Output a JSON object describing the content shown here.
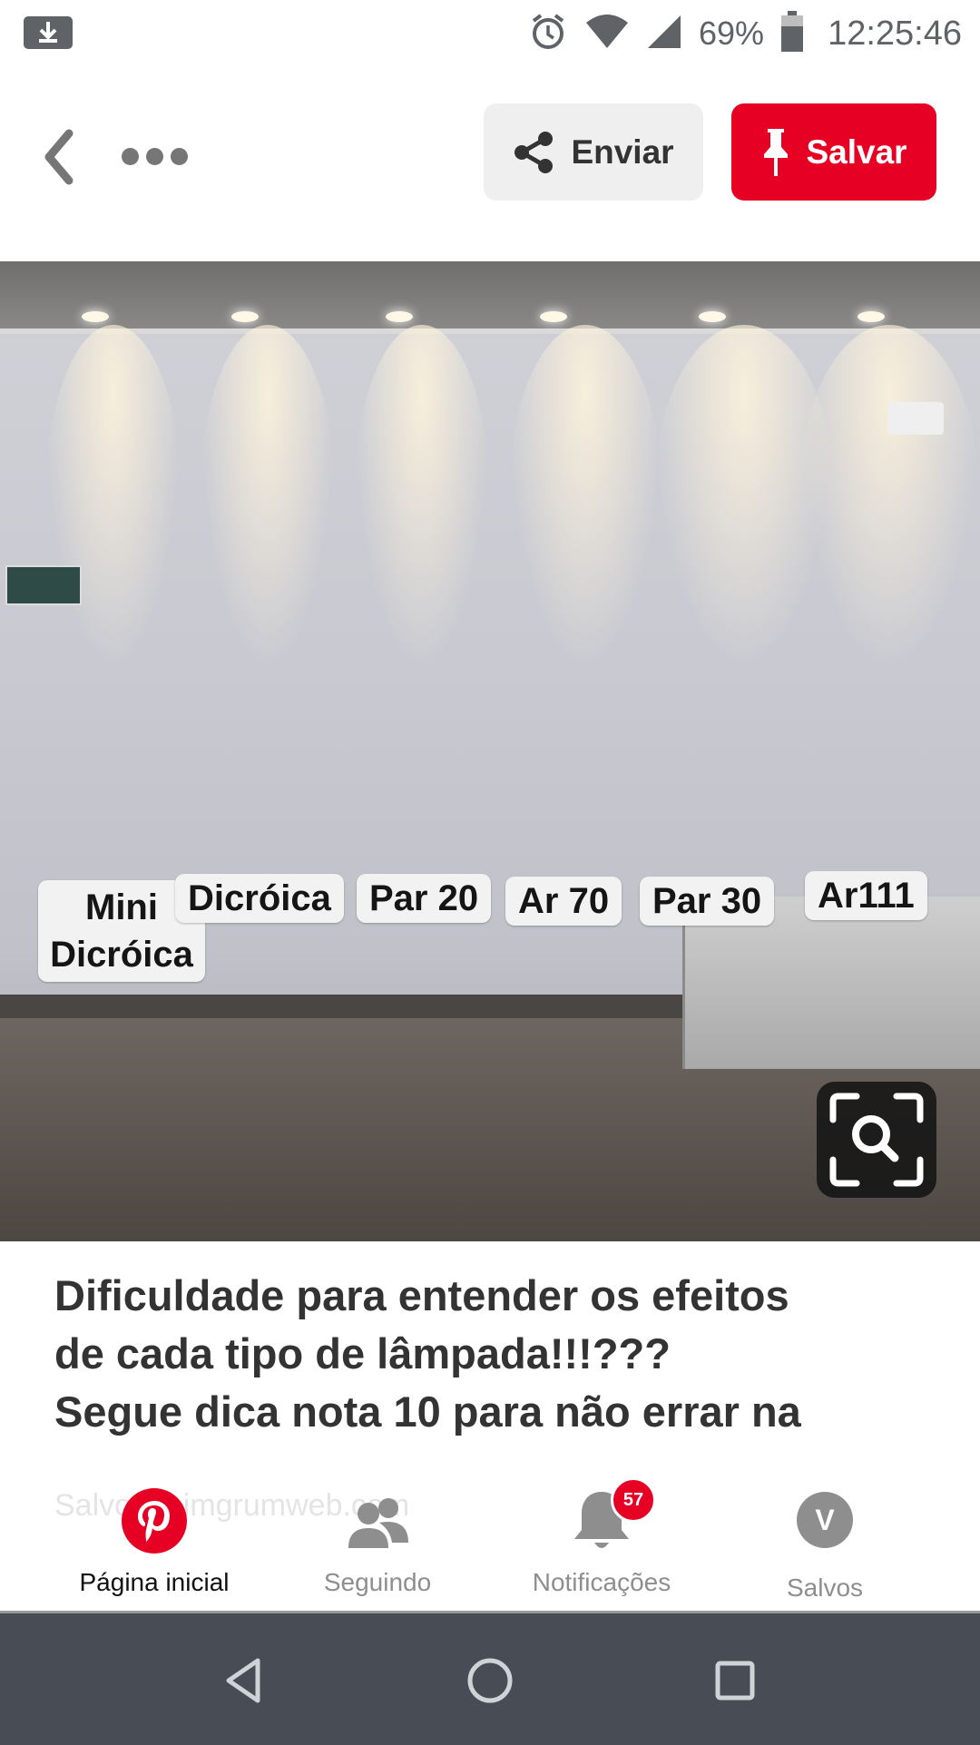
{
  "status_bar": {
    "battery_percent": "69%",
    "time": "12:25:46",
    "icons": [
      "download-icon",
      "alarm-icon",
      "wifi-icon",
      "signal-icon",
      "battery-icon"
    ]
  },
  "header": {
    "send_label": "Enviar",
    "save_label": "Salvar",
    "colors": {
      "save_bg": "#e60023",
      "send_bg": "#efefef"
    }
  },
  "pin_image": {
    "labels": [
      "Mini Dicróica",
      "Dicróica",
      "Par 20",
      "Ar 70",
      "Par 30",
      "Ar111"
    ]
  },
  "pin": {
    "description_lines": [
      "Dificuldade para entender os efeitos",
      "de cada tipo de lâmpada!!!???",
      "Segue dica nota 10 para não errar na"
    ],
    "source_partial": "Salvo de imgrumweb.com"
  },
  "bottom_nav": {
    "items": [
      {
        "label": "Página inicial",
        "icon": "pinterest-logo-icon",
        "active": true
      },
      {
        "label": "Seguindo",
        "icon": "people-icon",
        "active": false
      },
      {
        "label": "Notificações",
        "icon": "bell-icon",
        "active": false,
        "badge": "57"
      },
      {
        "label": "Salvos",
        "icon": "avatar",
        "active": false,
        "avatar_letter": "V"
      }
    ]
  },
  "system_nav": {
    "icons": [
      "back-triangle-icon",
      "home-circle-icon",
      "recents-square-icon"
    ]
  }
}
